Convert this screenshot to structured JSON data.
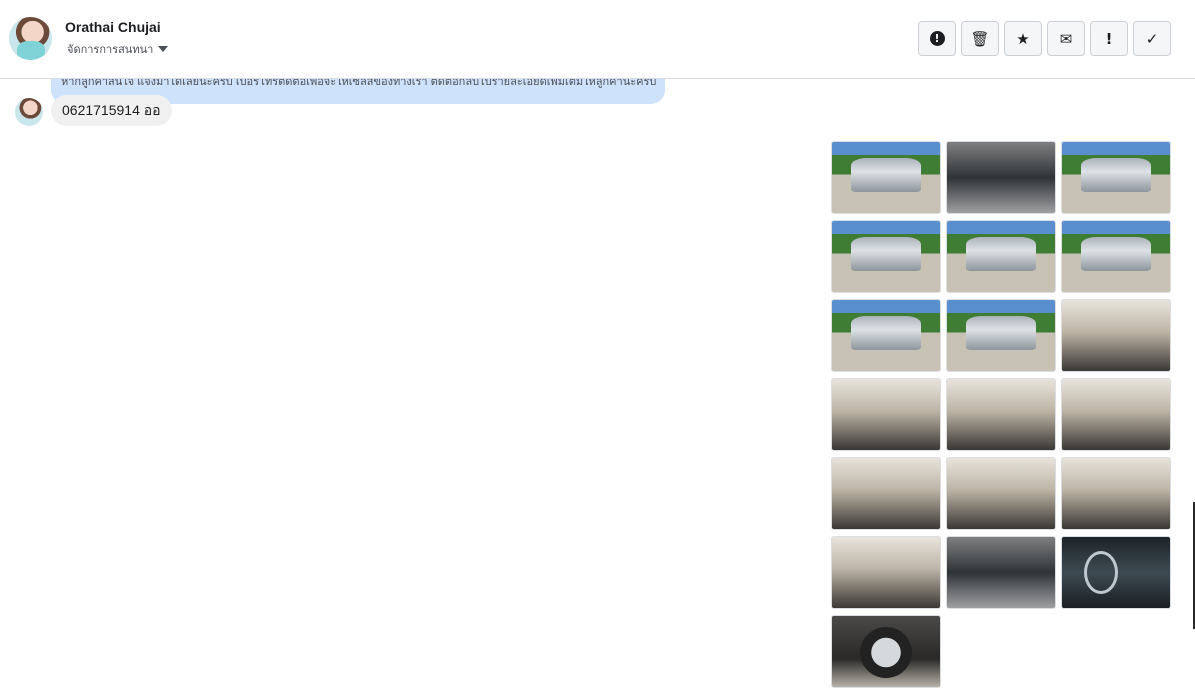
{
  "header": {
    "contact_name": "Orathai Chujai",
    "conversation_menu": "จัดการการสนทนา",
    "toolbar": [
      {
        "name": "report-spam-button",
        "icon": "alert-circle-icon",
        "glyph": "⏺"
      },
      {
        "name": "delete-button",
        "icon": "trash-icon",
        "glyph": "🗑"
      },
      {
        "name": "star-button",
        "icon": "star-icon",
        "glyph": "★"
      },
      {
        "name": "mark-unread-button",
        "icon": "envelope-icon",
        "glyph": "✉"
      },
      {
        "name": "mark-important-button",
        "icon": "exclamation-icon",
        "glyph": "!"
      },
      {
        "name": "mark-done-button",
        "icon": "checkmark-icon",
        "glyph": "✓"
      }
    ]
  },
  "messages": {
    "partial_text": "หากลูกค้าสนใจ แจ้งมาได้เลยนะครับ เบอร์โทรติดต่อเพื่อจะให้เซลส์ของทางเรา ติดต่อกลับไปรายละเอียดเพิ่มเติมให้ลูกค้านะครับ",
    "phone_message": "0621715914 ออ"
  },
  "photos": [
    {
      "kind": "ext",
      "icon": "car-photo-icon"
    },
    {
      "kind": "eng",
      "icon": "engine-photo-icon"
    },
    {
      "kind": "ext",
      "icon": "car-photo-icon"
    },
    {
      "kind": "ext",
      "icon": "car-photo-icon"
    },
    {
      "kind": "ext",
      "icon": "car-photo-icon"
    },
    {
      "kind": "ext",
      "icon": "car-photo-icon"
    },
    {
      "kind": "ext",
      "icon": "car-photo-icon"
    },
    {
      "kind": "ext",
      "icon": "car-photo-icon"
    },
    {
      "kind": "int",
      "icon": "interior-photo-icon"
    },
    {
      "kind": "int",
      "icon": "interior-photo-icon"
    },
    {
      "kind": "int",
      "icon": "interior-photo-icon"
    },
    {
      "kind": "int",
      "icon": "interior-photo-icon"
    },
    {
      "kind": "int",
      "icon": "interior-photo-icon"
    },
    {
      "kind": "int",
      "icon": "interior-photo-icon"
    },
    {
      "kind": "int",
      "icon": "interior-photo-icon"
    },
    {
      "kind": "int",
      "icon": "interior-photo-icon"
    },
    {
      "kind": "eng",
      "icon": "engine-photo-icon"
    },
    {
      "kind": "dash",
      "icon": "gauge-photo-icon"
    },
    {
      "kind": "wheel",
      "icon": "wheel-photo-icon"
    }
  ],
  "colors": {
    "sent_bubble": "#cfe2fb",
    "received_bubble": "#f1f0f0",
    "border": "#dadde1"
  }
}
